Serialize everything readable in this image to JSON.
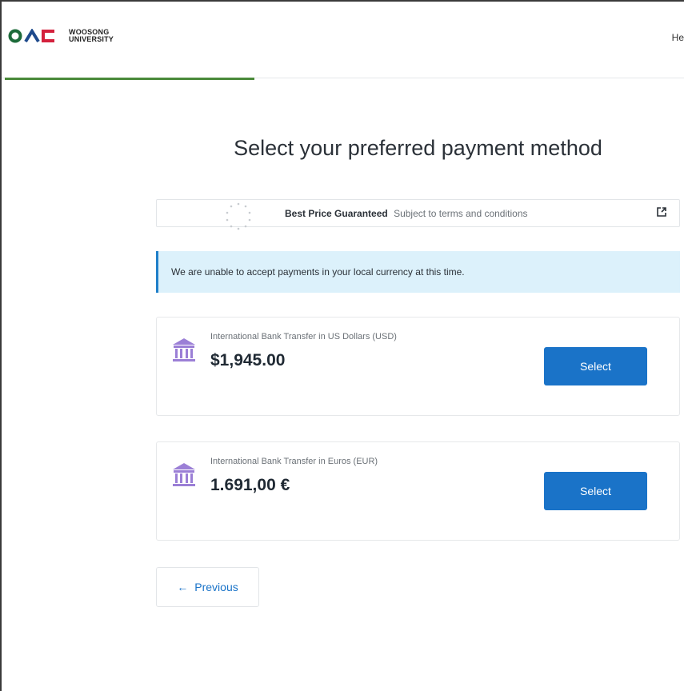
{
  "header": {
    "logo_text_line1": "WOOSONG",
    "logo_text_line2": "UNIVERSITY",
    "right_link": "He"
  },
  "page": {
    "title": "Select your preferred payment method"
  },
  "guarantee": {
    "strong": "Best Price Guaranteed",
    "sub": "Subject to terms and conditions",
    "icon": "external-link-icon"
  },
  "banner": {
    "text": "We are unable to accept payments in your local currency at this time."
  },
  "options": [
    {
      "label": "International Bank Transfer in US Dollars (USD)",
      "amount": "$1,945.00",
      "button": "Select",
      "icon": "bank-icon"
    },
    {
      "label": "International Bank Transfer in Euros (EUR)",
      "amount": "1.691,00 €",
      "button": "Select",
      "icon": "bank-icon"
    }
  ],
  "nav": {
    "previous": "Previous"
  },
  "colors": {
    "primary": "#1a73c8",
    "progress": "#4a8a3a",
    "banner_bg": "#dcf1fb",
    "banner_accent": "#1f7fc9",
    "bank_icon": "#9b7fd6",
    "logo_green": "#1d6b3a",
    "logo_blue": "#1e4a8c",
    "logo_red": "#d4213d"
  }
}
